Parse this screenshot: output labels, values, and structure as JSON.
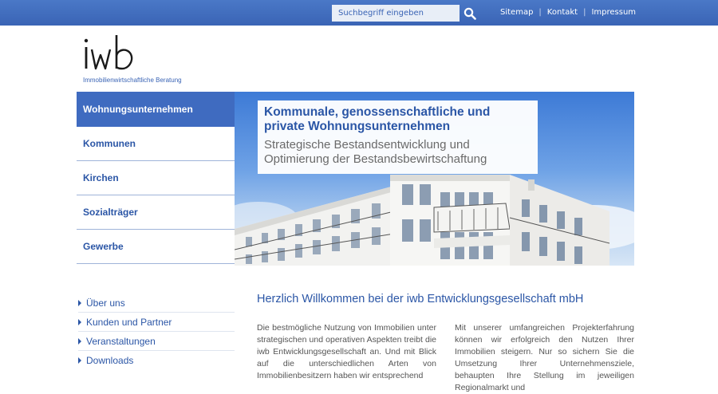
{
  "header": {
    "search_placeholder": "Suchbegriff eingeben",
    "links": [
      "Sitemap",
      "Kontakt",
      "Impressum"
    ],
    "colors": {
      "bar": "#3a64b5",
      "search_bg": "#e8eef7"
    }
  },
  "logo": {
    "mark": "iwb",
    "subtitle": "Immobilienwirtschaftliche Beratung"
  },
  "nav": {
    "items": [
      {
        "label": "Wohnungsunternehmen",
        "active": true
      },
      {
        "label": "Kommunen",
        "active": false
      },
      {
        "label": "Kirchen",
        "active": false
      },
      {
        "label": "Sozialträger",
        "active": false
      },
      {
        "label": "Gewerbe",
        "active": false
      }
    ]
  },
  "hero": {
    "title_line1": "Kommunale, genossenschaftliche und",
    "title_line2": "private Wohnungsunternehmen",
    "sub_line1": "Strategische Bestandsentwicklung und",
    "sub_line2": "Optimierung der Bestandsbewirtschaftung"
  },
  "subnav": {
    "items": [
      "Über uns",
      "Kunden und Partner",
      "Veranstaltungen",
      "Downloads"
    ]
  },
  "content": {
    "title": "Herzlich Willkommen bei der iwb Entwicklungsgesellschaft mbH",
    "col_left": "Die bestmögliche Nutzung von Immobilien unter strategischen und operativen Aspekten treibt die iwb Entwicklungsgesellschaft an. Und mit Blick auf die unterschiedlichen Arten von Immobilienbesitzern haben wir entsprechend",
    "col_right": "Mit unserer umfangreichen Projekterfahrung können wir erfolgreich den Nutzen Ihrer Immobilien steigern. Nur so sichern Sie die Umsetzung Ihrer Unternehmensziele, behaupten Ihre Stellung im jeweiligen Regionalmarkt und"
  },
  "icons": {
    "search": "search-icon",
    "arrow": "triangle-right-icon"
  }
}
